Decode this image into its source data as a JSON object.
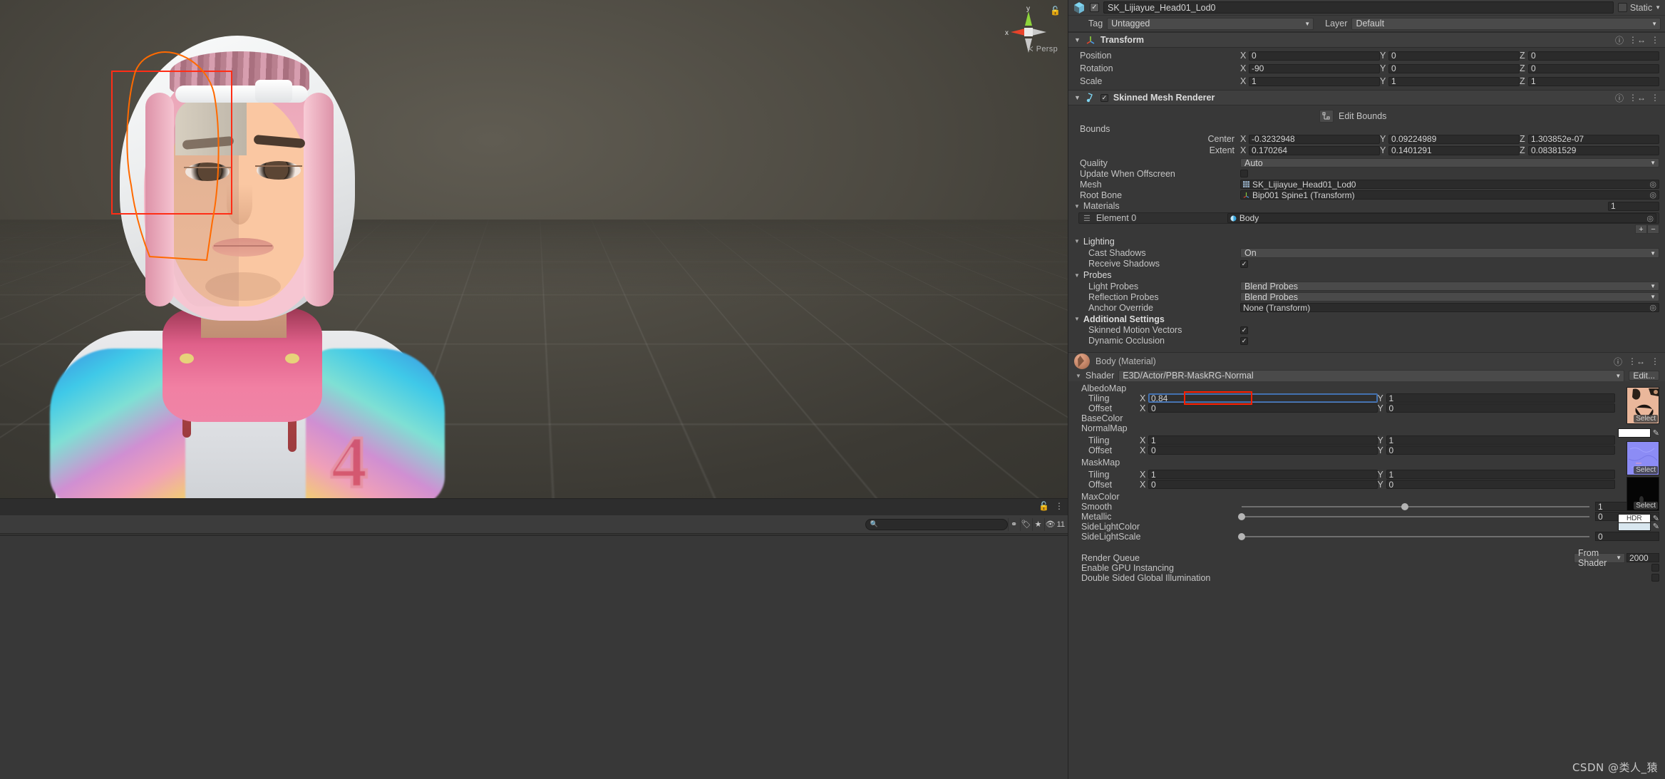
{
  "scene": {
    "gizmo": {
      "x_label": "x",
      "y_label": "y",
      "persp_label": "Persp",
      "persp_arrow": "≺"
    },
    "lock_icon": "lock-icon",
    "search_placeholder": "",
    "search_value": "",
    "hidden_count": "11",
    "toolbar_icons": [
      "bone-filter-icon",
      "tag-icon",
      "star-icon",
      "eye-off-icon"
    ]
  },
  "inspector": {
    "object": {
      "name": "SK_Lijiayue_Head01_Lod0",
      "enabled": true,
      "static_label": "Static",
      "tag_label": "Tag",
      "tag_value": "Untagged",
      "layer_label": "Layer",
      "layer_value": "Default"
    },
    "transform": {
      "title": "Transform",
      "rows": [
        {
          "label": "Position",
          "x": "0",
          "y": "0",
          "z": "0"
        },
        {
          "label": "Rotation",
          "x": "-90",
          "y": "0",
          "z": "0"
        },
        {
          "label": "Scale",
          "x": "1",
          "y": "1",
          "z": "1"
        }
      ],
      "axis": {
        "x": "X",
        "y": "Y",
        "z": "Z"
      }
    },
    "smr": {
      "title": "Skinned Mesh Renderer",
      "enabled": true,
      "edit_bounds_label": "Edit Bounds",
      "bounds_label": "Bounds",
      "center_label": "Center",
      "extent_label": "Extent",
      "center": {
        "x": "-0.3232948",
        "y": "0.09224989",
        "z": "1.303852e-07"
      },
      "extent": {
        "x": "0.170264",
        "y": "0.1401291",
        "z": "0.08381529"
      },
      "quality_label": "Quality",
      "quality_value": "Auto",
      "update_offscreen_label": "Update When Offscreen",
      "update_offscreen_checked": false,
      "mesh_label": "Mesh",
      "mesh_value": "SK_Lijiayue_Head01_Lod0",
      "root_bone_label": "Root Bone",
      "root_bone_value": "Bip001 Spine1 (Transform)",
      "materials_label": "Materials",
      "materials_count": "1",
      "material_element_label": "Element 0",
      "material_element_value": "Body",
      "add_button": "+",
      "remove_button": "−",
      "lighting_label": "Lighting",
      "cast_shadows_label": "Cast Shadows",
      "cast_shadows_value": "On",
      "receive_shadows_label": "Receive Shadows",
      "receive_shadows_checked": true,
      "probes_label": "Probes",
      "light_probes_label": "Light Probes",
      "light_probes_value": "Blend Probes",
      "reflection_probes_label": "Reflection Probes",
      "reflection_probes_value": "Blend Probes",
      "anchor_override_label": "Anchor Override",
      "anchor_override_value": "None (Transform)",
      "additional_settings_label": "Additional Settings",
      "skinned_motion_label": "Skinned Motion Vectors",
      "skinned_motion_checked": true,
      "dynamic_occlusion_label": "Dynamic Occlusion",
      "dynamic_occlusion_checked": true
    },
    "material": {
      "title": "Body (Material)",
      "shader_label": "Shader",
      "shader_value": "E3D/Actor/PBR-MaskRG-Normal",
      "edit_label": "Edit...",
      "albedo_label": "AlbedoMap",
      "albedo_tiling_label": "Tiling",
      "albedo_tiling_x": "0.84",
      "albedo_tiling_y": "1",
      "albedo_offset_label": "Offset",
      "albedo_offset_x": "0",
      "albedo_offset_y": "0",
      "basecolor_label": "BaseColor",
      "basecolor_hex": "#ffffff",
      "normal_label": "NormalMap",
      "normal_tiling_label": "Tiling",
      "normal_tiling_x": "1",
      "normal_tiling_y": "1",
      "normal_offset_label": "Offset",
      "normal_offset_x": "0",
      "normal_offset_y": "0",
      "mask_label": "MaskMap",
      "mask_tiling_label": "Tiling",
      "mask_tiling_x": "1",
      "mask_tiling_y": "1",
      "mask_offset_label": "Offset",
      "mask_offset_x": "0",
      "mask_offset_y": "0",
      "maxcolor_label": "MaxColor",
      "maxcolor_badge": "HDR",
      "smooth_label": "Smooth",
      "smooth_value": "1",
      "smooth_pct": 47,
      "metallic_label": "Metallic",
      "metallic_value": "0",
      "metallic_pct": 0,
      "sidelightcolor_label": "SideLightColor",
      "sidelightcolor_hex": "#d9e7ef",
      "sidelightscale_label": "SideLightScale",
      "sidelightscale_value": "0",
      "sidelightscale_pct": 0,
      "render_queue_label": "Render Queue",
      "render_queue_mode": "From Shader",
      "render_queue_value": "2000",
      "gpu_instancing_label": "Enable GPU Instancing",
      "gpu_instancing_checked": false,
      "double_sided_gi_label": "Double Sided Global Illumination",
      "double_sided_gi_checked": false,
      "select_label": "Select"
    }
  },
  "watermark": "CSDN @类人_猿",
  "colors": {
    "accent_blue": "#4a78b8",
    "highlight_red": "#ff1f00",
    "axis_x": "#e8432a",
    "axis_y": "#8ed43b",
    "panel_bg": "#383838"
  }
}
